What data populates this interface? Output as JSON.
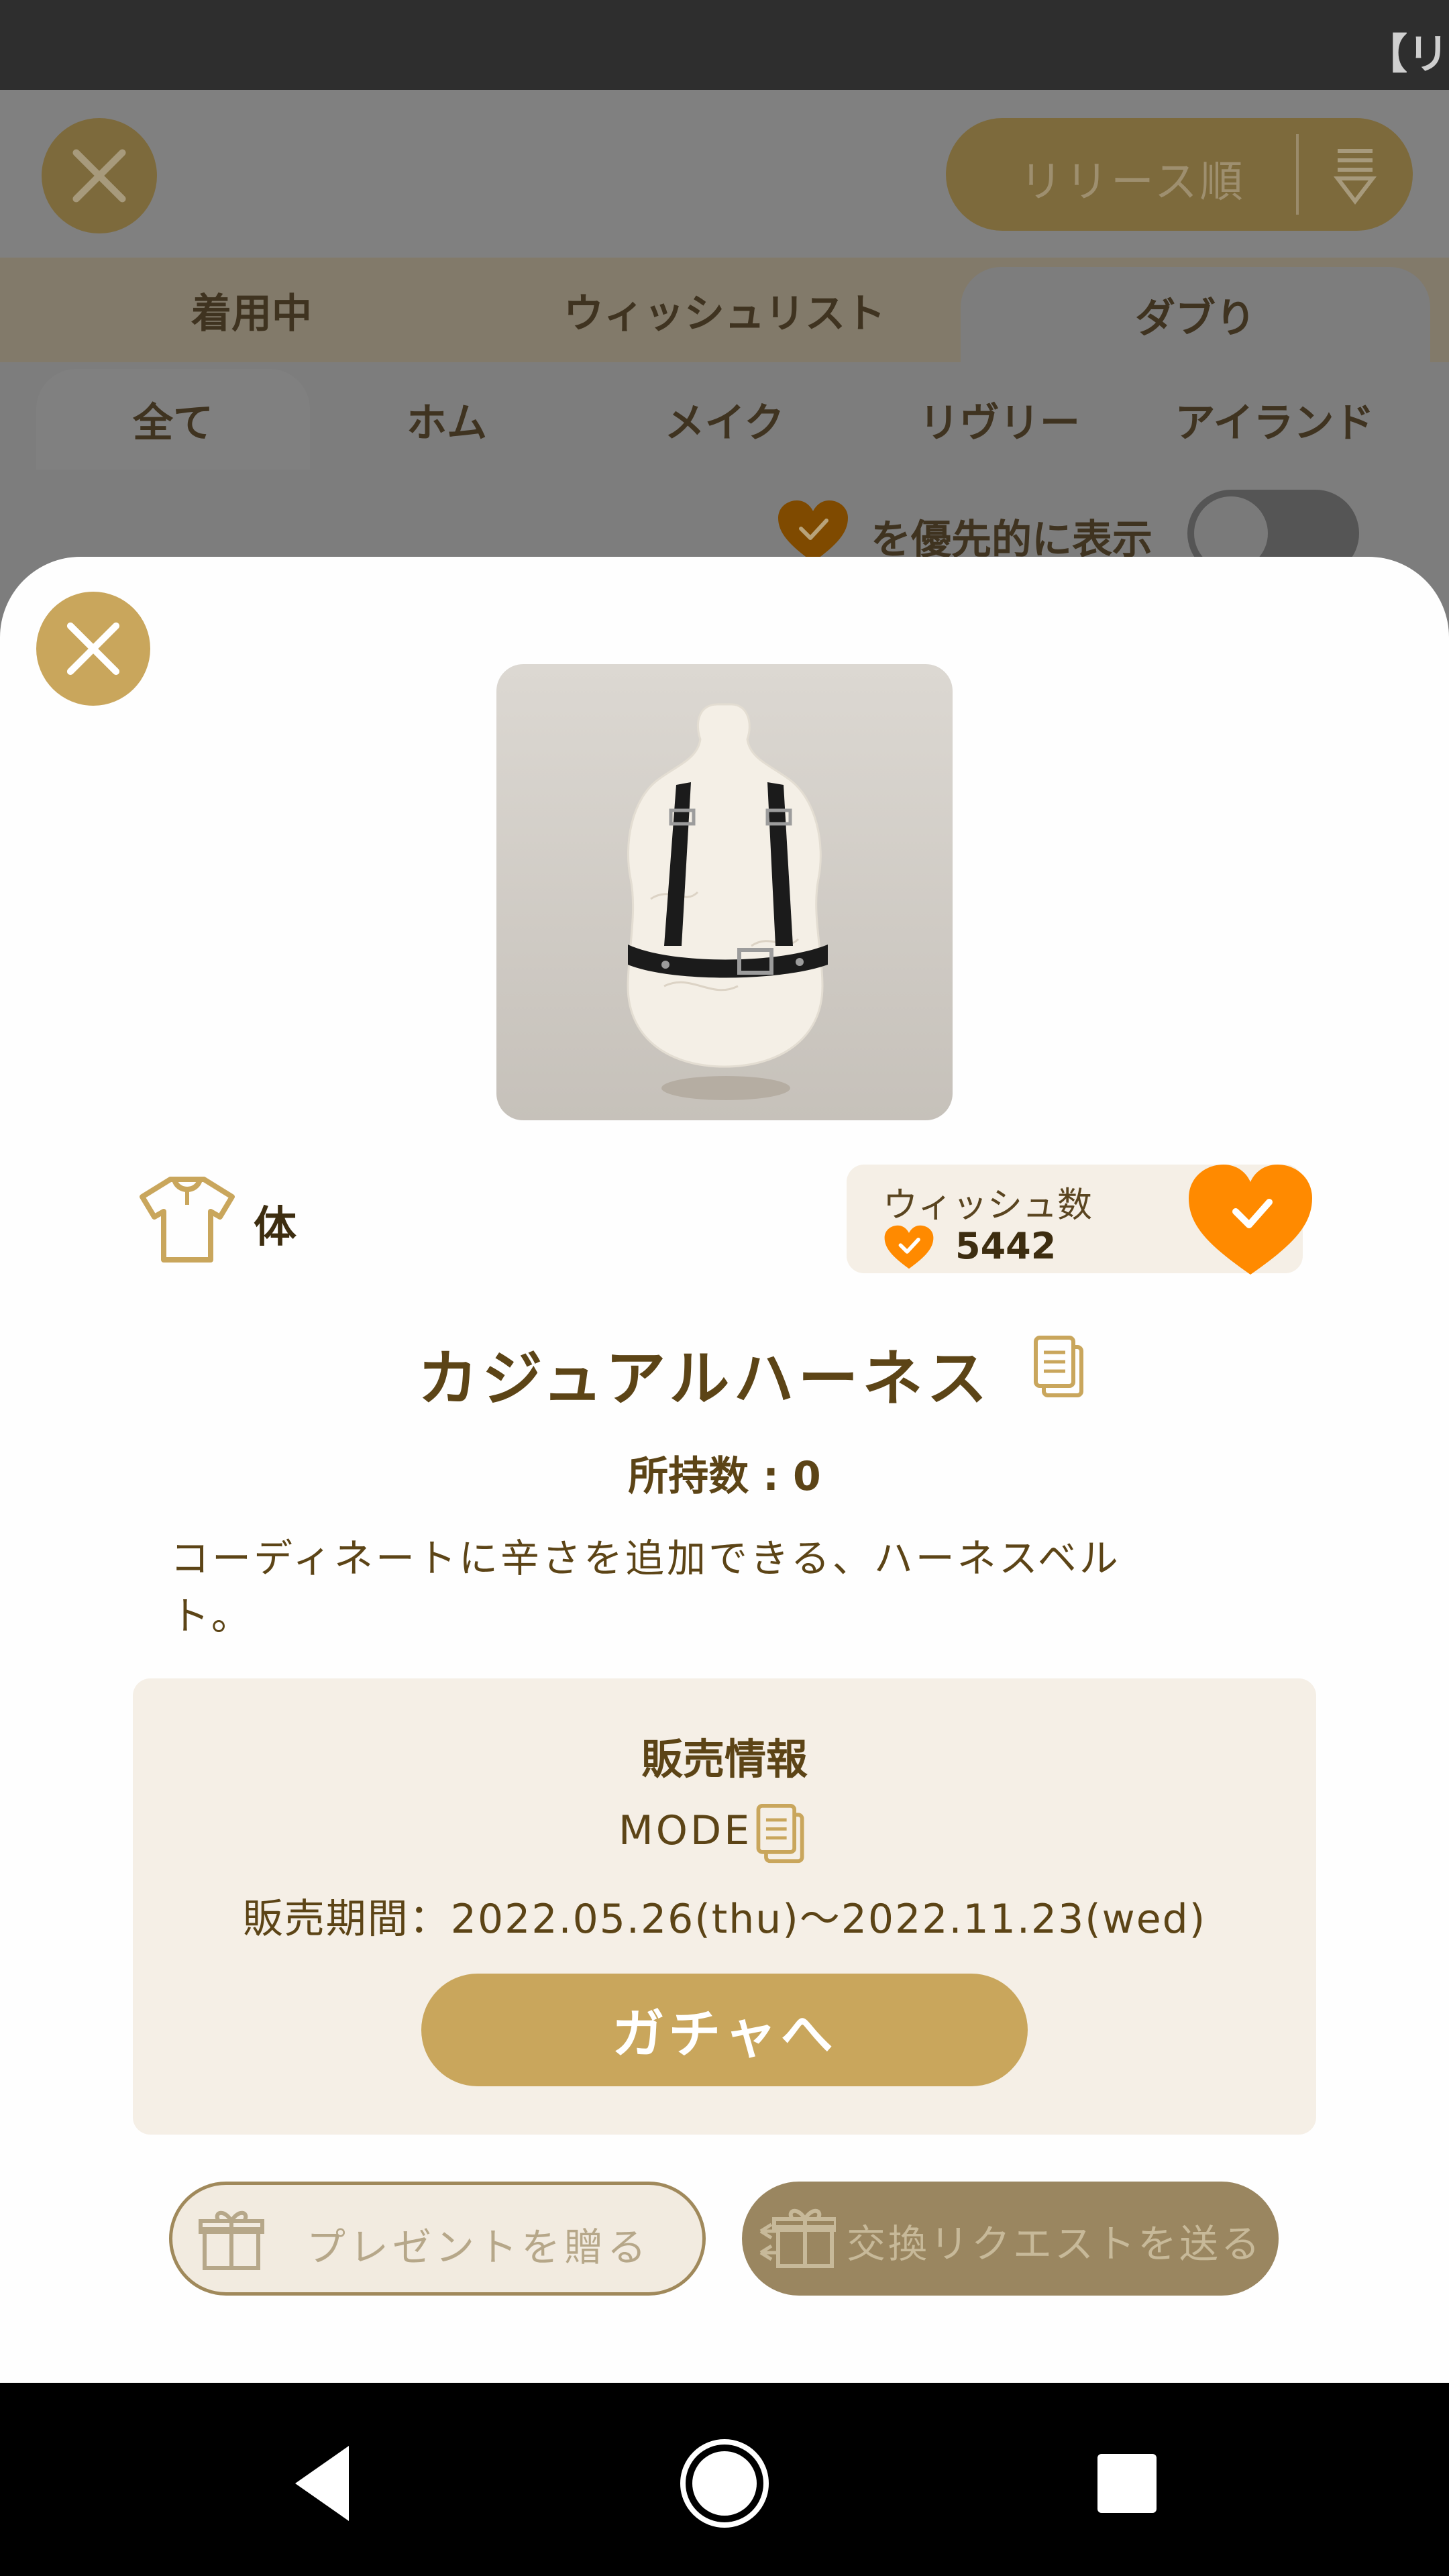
{
  "status_bar": {
    "text": "【リ"
  },
  "background": {
    "sort_label": "リリース順",
    "tabs": [
      {
        "label": "着用中"
      },
      {
        "label": "ウィッシュリスト"
      },
      {
        "label": "ダブり"
      }
    ],
    "sub_tabs": [
      {
        "label": "全て"
      },
      {
        "label": "ホム"
      },
      {
        "label": "メイク"
      },
      {
        "label": "リヴリー"
      },
      {
        "label": "アイランド"
      }
    ],
    "priority_label": "を優先的に表示",
    "priority_toggle_on": false
  },
  "modal": {
    "category_label": "体",
    "category_icon": "shirt-icon",
    "wish": {
      "title": "ウィッシュ数",
      "count": "5442",
      "wished": true
    },
    "item_title": "カジュアルハーネス",
    "owned_count": "所持数 : 0",
    "description": "コーディネートに辛さを追加できる、ハーネスベルト。",
    "sales": {
      "title": "販売情報",
      "mode": "MODE",
      "period": "販売期間：2022.05.26(thu)〜2022.11.23(wed)",
      "gacha_button": "ガチャへ"
    },
    "present_button": "プレゼントを贈る",
    "trade_button": "交換リクエストを送る"
  },
  "colors": {
    "accent_gold": "#c9a65c",
    "heart_orange": "#ff8a00",
    "text_brown": "#5c4416",
    "panel_cream": "#f5efe6"
  }
}
